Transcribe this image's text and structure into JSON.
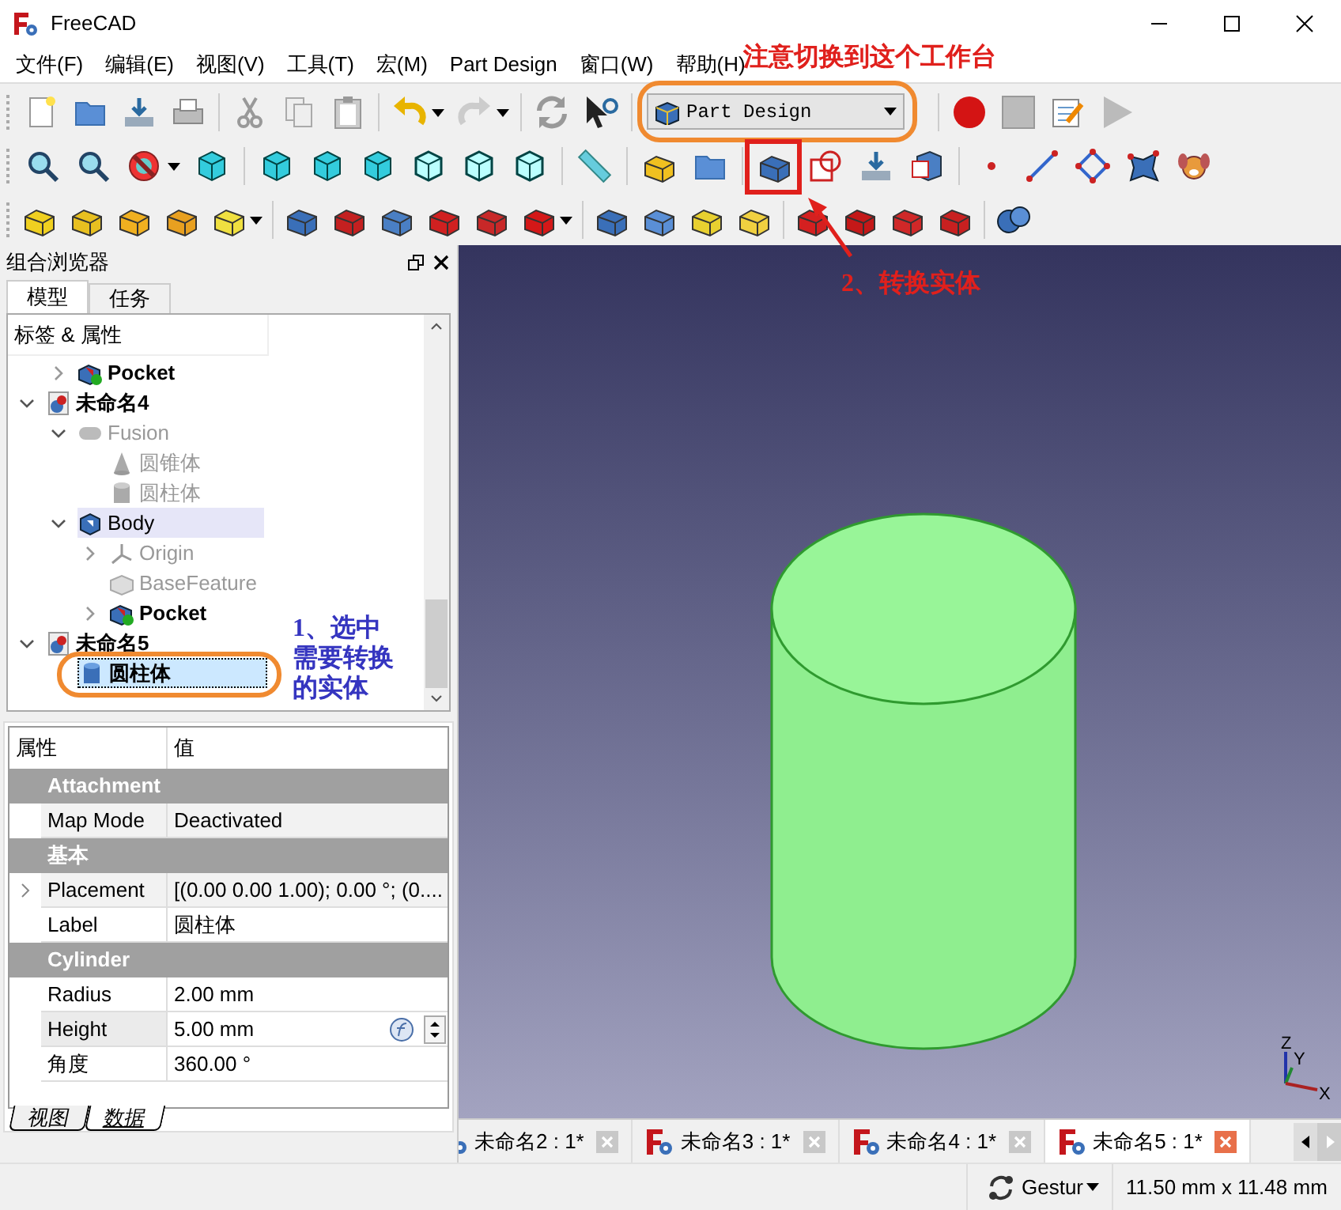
{
  "window": {
    "title": "FreeCAD"
  },
  "menu": [
    "文件(F)",
    "编辑(E)",
    "视图(V)",
    "工具(T)",
    "宏(M)",
    "Part Design",
    "窗口(W)",
    "帮助(H)"
  ],
  "workbench": {
    "value": "Part Design"
  },
  "combo_view": {
    "title": "组合浏览器",
    "tabs": [
      {
        "label": "模型",
        "selected": true
      },
      {
        "label": "任务",
        "selected": false
      }
    ],
    "tree": {
      "header": "标签 & 属性",
      "items": [
        {
          "children": [
            {
              "label": "Pocket",
              "kind": "pocket",
              "expanded": false,
              "bold": true,
              "hidden": false,
              "selected": false
            }
          ]
        },
        {
          "label": "未命名4",
          "kind": "document",
          "expanded": true,
          "bold": true,
          "hidden": false,
          "selected": false,
          "children": [
            {
              "label": "Fusion",
              "kind": "fusion",
              "expanded": true,
              "bold": false,
              "hidden": true,
              "selected": false,
              "children": [
                {
                  "label": "圆锥体",
                  "kind": "cone",
                  "bold": false,
                  "hidden": true,
                  "selected": false
                },
                {
                  "label": "圆柱体",
                  "kind": "cylinder",
                  "bold": false,
                  "hidden": true,
                  "selected": false
                }
              ]
            },
            {
              "label": "Body",
              "kind": "body",
              "expanded": true,
              "bold": false,
              "hidden": false,
              "active": true,
              "selected": false,
              "children": [
                {
                  "label": "Origin",
                  "kind": "origin",
                  "expanded": false,
                  "bold": false,
                  "hidden": true,
                  "selected": false
                },
                {
                  "label": "BaseFeature",
                  "kind": "base",
                  "bold": false,
                  "hidden": true,
                  "selected": false
                },
                {
                  "label": "Pocket",
                  "kind": "pocket",
                  "expanded": false,
                  "bold": true,
                  "hidden": false,
                  "selected": false
                }
              ]
            }
          ]
        },
        {
          "label": "未命名5",
          "kind": "document",
          "expanded": true,
          "bold": true,
          "hidden": false,
          "selected": false,
          "children": [
            {
              "label": "圆柱体",
              "kind": "solid",
              "bold": true,
              "hidden": false,
              "selected": true
            }
          ]
        }
      ]
    }
  },
  "properties": {
    "columns": [
      "属性",
      "值"
    ],
    "rows": [
      {
        "kind": "group",
        "name": "Attachment"
      },
      {
        "kind": "property",
        "name": "Map Mode",
        "value": "Deactivated",
        "readonly": true
      },
      {
        "kind": "group",
        "name": "基本"
      },
      {
        "kind": "property",
        "name": "Placement",
        "value": "[(0.00 0.00 1.00); 0.00 °; (0....",
        "readonly": true,
        "expanded": false
      },
      {
        "kind": "property",
        "name": "Label",
        "value": "圆柱体"
      },
      {
        "kind": "group",
        "name": "Cylinder"
      },
      {
        "kind": "property",
        "name": "Radius",
        "value": "2.00 mm"
      },
      {
        "kind": "property",
        "name": "Height",
        "value": "5.00 mm",
        "editing": true
      },
      {
        "kind": "property",
        "name": "角度",
        "value": "360.00 °"
      }
    ],
    "tabs": [
      {
        "label": "视图",
        "selected": false
      },
      {
        "label": "数据",
        "selected": true
      }
    ]
  },
  "view": {
    "axis_labels": [
      "Z",
      "Y",
      "X"
    ]
  },
  "documents": [
    {
      "label": "未命名2 : 1*",
      "selected": false,
      "icon_cut": true
    },
    {
      "label": "未命名3 : 1*",
      "selected": false
    },
    {
      "label": "未命名4 : 1*",
      "selected": false
    },
    {
      "label": "未命名5 : 1*",
      "selected": true
    }
  ],
  "status_bar": {
    "navigation": "Gestur",
    "dimensions": "11.50 mm x 11.48 mm"
  },
  "annotations": [
    {
      "kind": "workbench-note",
      "text": "注意切换到这个工作台",
      "color": "#e0201c"
    },
    {
      "kind": "convert-note",
      "text": "2、转换实体",
      "color": "#e0201c"
    },
    {
      "kind": "select-note",
      "text": "1、选中需要转换的实体",
      "color": "#3535c0"
    }
  ]
}
